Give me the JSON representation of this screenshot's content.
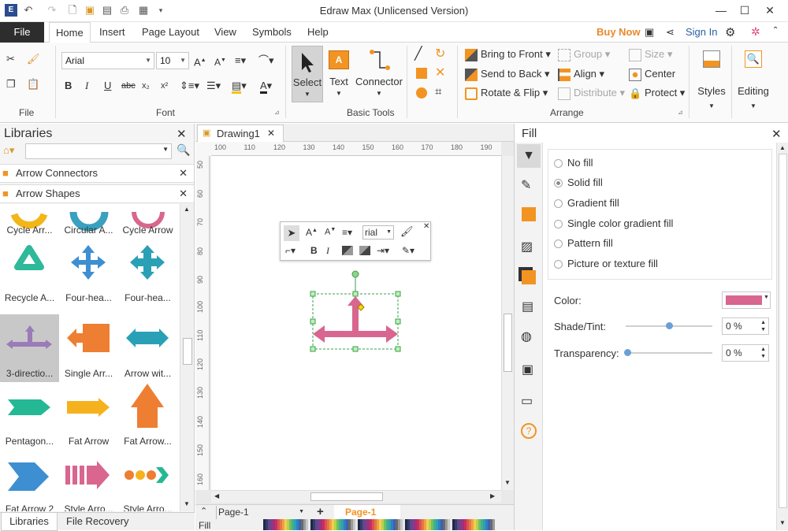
{
  "window": {
    "title": "Edraw Max (Unlicensed Version)"
  },
  "menu": {
    "file": "File",
    "tabs": [
      "Home",
      "Insert",
      "Page Layout",
      "View",
      "Symbols",
      "Help"
    ],
    "buy_now": "Buy Now",
    "sign_in": "Sign In"
  },
  "ribbon": {
    "font_name": "Arial",
    "font_size": "10",
    "groups": {
      "file": "File",
      "font": "Font",
      "basic_tools": "Basic Tools",
      "arrange": "Arrange"
    },
    "tools": {
      "select": "Select",
      "text": "Text",
      "connector": "Connector"
    },
    "arrange": {
      "bring_to_front": "Bring to Front",
      "send_to_back": "Send to Back",
      "rotate_flip": "Rotate & Flip",
      "group": "Group",
      "align": "Align",
      "distribute": "Distribute",
      "size": "Size",
      "center": "Center",
      "protect": "Protect"
    },
    "styles": "Styles",
    "editing": "Editing"
  },
  "libraries": {
    "title": "Libraries",
    "search_placeholder": "",
    "sections": [
      "Arrow Connectors",
      "Arrow Shapes"
    ],
    "shapes": [
      {
        "label": "Cycle Arr...",
        "icon": "cycle-arrow-orange"
      },
      {
        "label": "Circular A...",
        "icon": "circular-arrow-blue"
      },
      {
        "label": "Cycle Arrow",
        "icon": "cycle-arrow-pink"
      },
      {
        "label": "Recycle A...",
        "icon": "recycle-arrow"
      },
      {
        "label": "Four-hea...",
        "icon": "four-headed-arrow-blue"
      },
      {
        "label": "Four-hea...",
        "icon": "four-headed-arrow-teal"
      },
      {
        "label": "3-directio...",
        "icon": "three-direction-arrow"
      },
      {
        "label": "Single Arr...",
        "icon": "single-arrow"
      },
      {
        "label": "Arrow wit...",
        "icon": "arrow-with-tails"
      },
      {
        "label": "Pentagon...",
        "icon": "pentagon-arrow"
      },
      {
        "label": "Fat Arrow",
        "icon": "fat-arrow"
      },
      {
        "label": "Fat Arrow...",
        "icon": "fat-arrow-up"
      },
      {
        "label": "Fat Arrow 2",
        "icon": "fat-arrow-2"
      },
      {
        "label": "Style Arro...",
        "icon": "style-arrow-1"
      },
      {
        "label": "Style Arro...",
        "icon": "style-arrow-2"
      }
    ],
    "bottom_tabs": [
      "Libraries",
      "File Recovery"
    ]
  },
  "document": {
    "tab": "Drawing1",
    "ruler_h": [
      "100",
      "110",
      "120",
      "130",
      "140",
      "150",
      "160",
      "170",
      "180",
      "190"
    ],
    "ruler_v": [
      "50",
      "60",
      "70",
      "80",
      "90",
      "100",
      "110",
      "120",
      "130",
      "140",
      "150",
      "160"
    ],
    "mini_font": "rial",
    "page_select": "Page-1",
    "page_tab": "Page-1",
    "fill_label": "Fill",
    "shape_color": "#d8668e"
  },
  "fill_panel": {
    "title": "Fill",
    "options": [
      "No fill",
      "Solid fill",
      "Gradient fill",
      "Single color gradient fill",
      "Pattern fill",
      "Picture or texture fill"
    ],
    "selected": "Solid fill",
    "color_label": "Color:",
    "shade_label": "Shade/Tint:",
    "shade_value": "0 %",
    "transparency_label": "Transparency:",
    "transparency_value": "0 %",
    "color_swatch": "#d8668e"
  }
}
